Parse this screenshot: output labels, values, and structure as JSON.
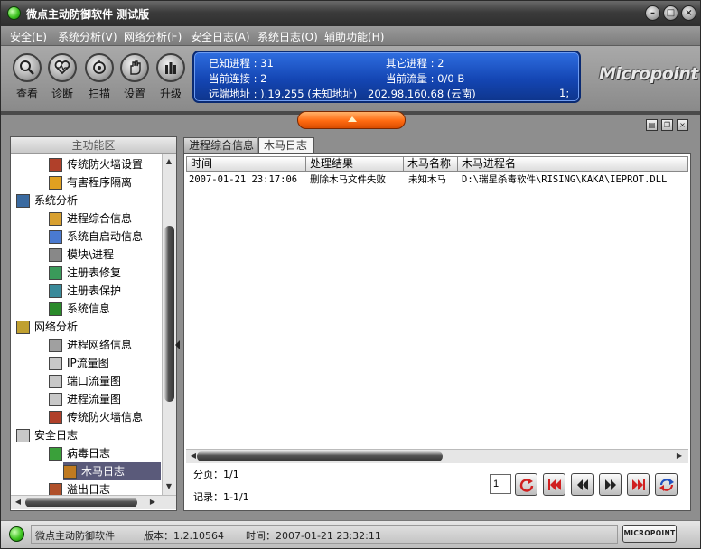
{
  "window": {
    "title": "微点主动防御软件  测试版"
  },
  "menu": [
    {
      "label": "安全(E)"
    },
    {
      "label": "系统分析(V)"
    },
    {
      "label": "网络分析(F)"
    },
    {
      "label": "安全日志(A)"
    },
    {
      "label": "系统日志(O)"
    },
    {
      "label": "辅助功能(H)"
    }
  ],
  "toolbar": {
    "tools": [
      {
        "label": "查看",
        "icon": "magnifier-icon"
      },
      {
        "label": "诊断",
        "icon": "heart-icon"
      },
      {
        "label": "扫描",
        "icon": "scan-icon"
      },
      {
        "label": "设置",
        "icon": "hand-icon"
      },
      {
        "label": "升级",
        "icon": "upgrade-icon"
      }
    ]
  },
  "info": {
    "known_process": "已知进程 : 31",
    "other_process": "其它进程 : 2",
    "current_connection": "当前连接 : 2",
    "current_traffic": "当前流量 : 0/0 B",
    "remote_label": "远端地址 : ).19.255 (未知地址)",
    "remote_ip": "202.98.160.68 (云南)",
    "remote_extra": "1;"
  },
  "logo": "Micropoint",
  "left_panel": {
    "header": "主功能区",
    "tree": [
      {
        "label": "传统防火墙设置",
        "level": 2,
        "icon_color": "#b0402a",
        "selected": false
      },
      {
        "label": "有害程序隔离",
        "level": 2,
        "icon_color": "#e0a020",
        "selected": false
      },
      {
        "label": "系统分析",
        "level": 1,
        "icon_color": "#3a6aa0",
        "selected": false
      },
      {
        "label": "进程综合信息",
        "level": 2,
        "icon_color": "#d8a030",
        "selected": false
      },
      {
        "label": "系统自启动信息",
        "level": 2,
        "icon_color": "#4a7ad0",
        "selected": false
      },
      {
        "label": "模块\\进程",
        "level": 2,
        "icon_color": "#888888",
        "selected": false
      },
      {
        "label": "注册表修复",
        "level": 2,
        "icon_color": "#3a9a5a",
        "selected": false
      },
      {
        "label": "注册表保护",
        "level": 2,
        "icon_color": "#3a8a9a",
        "selected": false
      },
      {
        "label": "系统信息",
        "level": 2,
        "icon_color": "#2a8a2a",
        "selected": false
      },
      {
        "label": "网络分析",
        "level": 1,
        "icon_color": "#c0a030",
        "selected": false
      },
      {
        "label": "进程网络信息",
        "level": 2,
        "icon_color": "#a0a0a0",
        "selected": false
      },
      {
        "label": "IP流量图",
        "level": 2,
        "icon_color": "#c8c8c8",
        "selected": false
      },
      {
        "label": "端口流量图",
        "level": 2,
        "icon_color": "#c8c8c8",
        "selected": false
      },
      {
        "label": "进程流量图",
        "level": 2,
        "icon_color": "#c8c8c8",
        "selected": false
      },
      {
        "label": "传统防火墙信息",
        "level": 2,
        "icon_color": "#b0402a",
        "selected": false
      },
      {
        "label": "安全日志",
        "level": 1,
        "icon_color": "#c8c8c8",
        "selected": false
      },
      {
        "label": "病毒日志",
        "level": 2,
        "icon_color": "#3aa03a",
        "selected": false
      },
      {
        "label": "木马日志",
        "level": 2,
        "icon_color": "#c07a20",
        "selected": true
      },
      {
        "label": "溢出日志",
        "level": 2,
        "icon_color": "#b0502a",
        "selected": false
      }
    ]
  },
  "tabs": [
    {
      "label": "进程综合信息",
      "active": false
    },
    {
      "label": "木马日志",
      "active": true
    }
  ],
  "table": {
    "columns": [
      "时间",
      "处理结果",
      "木马名称",
      "木马进程名"
    ],
    "rows": [
      [
        "2007-01-21 23:17:06",
        "删除木马文件失败",
        "未知木马",
        "D:\\瑞星杀毒软件\\RISING\\KAKA\\IEPROT.DLL"
      ]
    ]
  },
  "pager": {
    "page": "分页：1/1",
    "records": "记录：1-1/1",
    "page_input": "1"
  },
  "status": {
    "app": "微点主动防御软件",
    "version": "版本：1.2.10564",
    "time": "时间：2007-01-21 23:32:11",
    "logo": "MICROPOINT"
  },
  "colors": {
    "panel_blue": "#1446b4",
    "accent_orange": "#ff6a10",
    "selected_row": "#5a5a7a"
  }
}
